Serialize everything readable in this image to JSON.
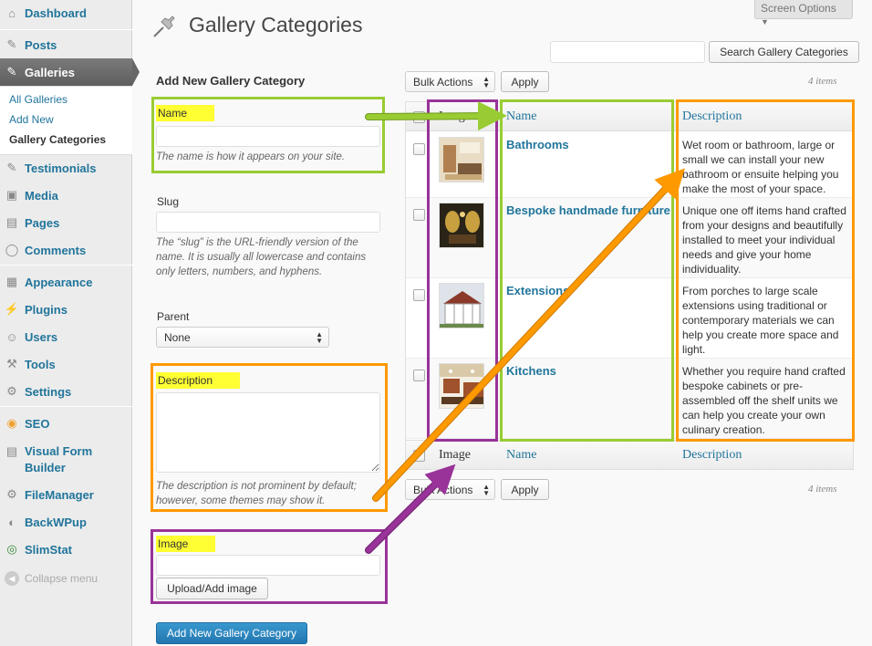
{
  "sidebar": {
    "items": [
      {
        "label": "Dashboard",
        "icon": "dashboard-icon"
      },
      {
        "label": "Posts",
        "icon": "pin-icon"
      },
      {
        "label": "Galleries",
        "icon": "pin-icon"
      },
      {
        "label": "Testimonials",
        "icon": "pin-icon"
      },
      {
        "label": "Media",
        "icon": "media-icon"
      },
      {
        "label": "Pages",
        "icon": "pages-icon"
      },
      {
        "label": "Comments",
        "icon": "comments-icon"
      },
      {
        "label": "Appearance",
        "icon": "appearance-icon"
      },
      {
        "label": "Plugins",
        "icon": "plugins-icon"
      },
      {
        "label": "Users",
        "icon": "users-icon"
      },
      {
        "label": "Tools",
        "icon": "tools-icon"
      },
      {
        "label": "Settings",
        "icon": "settings-icon"
      },
      {
        "label": "SEO",
        "icon": "seo-icon"
      },
      {
        "label": "Visual Form\nBuilder",
        "icon": "form-icon"
      },
      {
        "label": "FileManager",
        "icon": "gear-icon"
      },
      {
        "label": "BackWPup",
        "icon": "backup-icon"
      },
      {
        "label": "SlimStat",
        "icon": "stats-icon"
      }
    ],
    "galleries_submenu": [
      "All Galleries",
      "Add New",
      "Gallery Categories"
    ],
    "collapse_label": "Collapse menu"
  },
  "header": {
    "title": "Gallery Categories",
    "screen_options": "Screen Options",
    "search_button": "Search Gallery Categories",
    "search_value": ""
  },
  "form": {
    "heading": "Add New Gallery Category",
    "name_label": "Name",
    "name_hint": "The name is how it appears on your site.",
    "slug_label": "Slug",
    "slug_hint": "The “slug” is the URL-friendly version of the name. It is usually all lowercase and contains only letters, numbers, and hyphens.",
    "parent_label": "Parent",
    "parent_value": "None",
    "description_label": "Description",
    "description_hint": "The description is not prominent by default; however, some themes may show it.",
    "image_label": "Image",
    "upload_button": "Upload/Add image",
    "submit_button": "Add New Gallery Category"
  },
  "table": {
    "bulk_actions": "Bulk Actions",
    "apply": "Apply",
    "items_count": "4 items",
    "columns": {
      "image": "Image",
      "name": "Name",
      "description": "Description"
    },
    "rows": [
      {
        "name": "Bathrooms",
        "description": "Wet room or bathroom, large or small we can install your new bathroom or ensuite helping you make the most of your space.",
        "thumb_colors": [
          "#e8dcc4",
          "#b08050",
          "#7a5a3a"
        ]
      },
      {
        "name": "Bespoke handmade furniture",
        "description": "Unique one off items hand crafted from your designs and beautifully installed to meet your individual needs and give your home individuality.",
        "thumb_colors": [
          "#2a2418",
          "#c8a040",
          "#5a4020"
        ]
      },
      {
        "name": "Extensions",
        "description": "From porches to large scale extensions using traditional or contemporary materials we can help you create more space and light.",
        "thumb_colors": [
          "#dfe4ea",
          "#ffffff",
          "#8b3a2a"
        ]
      },
      {
        "name": "Kitchens",
        "description": "Whether you require hand crafted bespoke cabinets or pre-assembled off the shelf units we can help you create your own culinary creation.",
        "thumb_colors": [
          "#d9c9a8",
          "#a0522d",
          "#f4efe4"
        ]
      }
    ]
  },
  "annotation_colors": {
    "green": "#99cc33",
    "orange": "#ff9900",
    "purple": "#993399",
    "highlight": "#ffff33"
  }
}
